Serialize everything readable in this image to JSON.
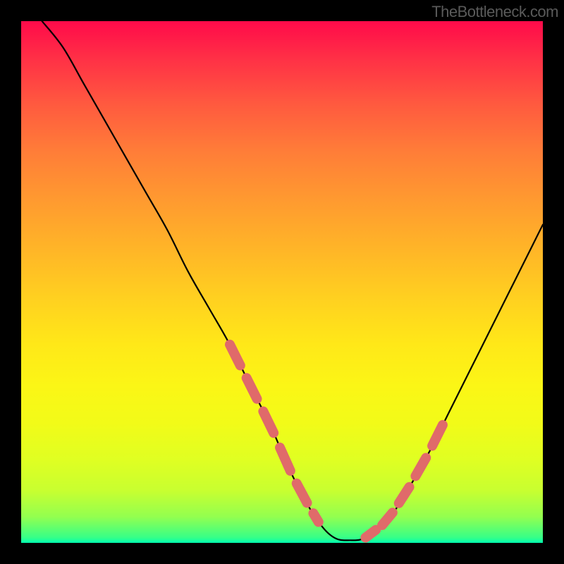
{
  "watermark": "TheBottleneck.com",
  "chart_data": {
    "type": "line",
    "title": "",
    "xlabel": "",
    "ylabel": "",
    "xlim": [
      0,
      100
    ],
    "ylim": [
      0,
      100
    ],
    "x": [
      4,
      8,
      12,
      16,
      20,
      24,
      28,
      32,
      36,
      40,
      44,
      48,
      51,
      54,
      57,
      60,
      63,
      66,
      70,
      74,
      78,
      82,
      86,
      90,
      94,
      98,
      100
    ],
    "values": [
      100,
      95,
      88,
      81,
      74,
      67,
      60,
      52,
      45,
      38,
      30,
      22,
      15,
      9,
      4,
      1,
      0.5,
      1,
      4,
      10,
      17,
      25,
      33,
      41,
      49,
      57,
      61
    ],
    "annotations": {
      "dotted_segments": [
        {
          "x_range": [
            40,
            57
          ],
          "side": "left"
        },
        {
          "x_range": [
            66,
            82
          ],
          "side": "right"
        }
      ],
      "minimum_x": 63
    }
  }
}
